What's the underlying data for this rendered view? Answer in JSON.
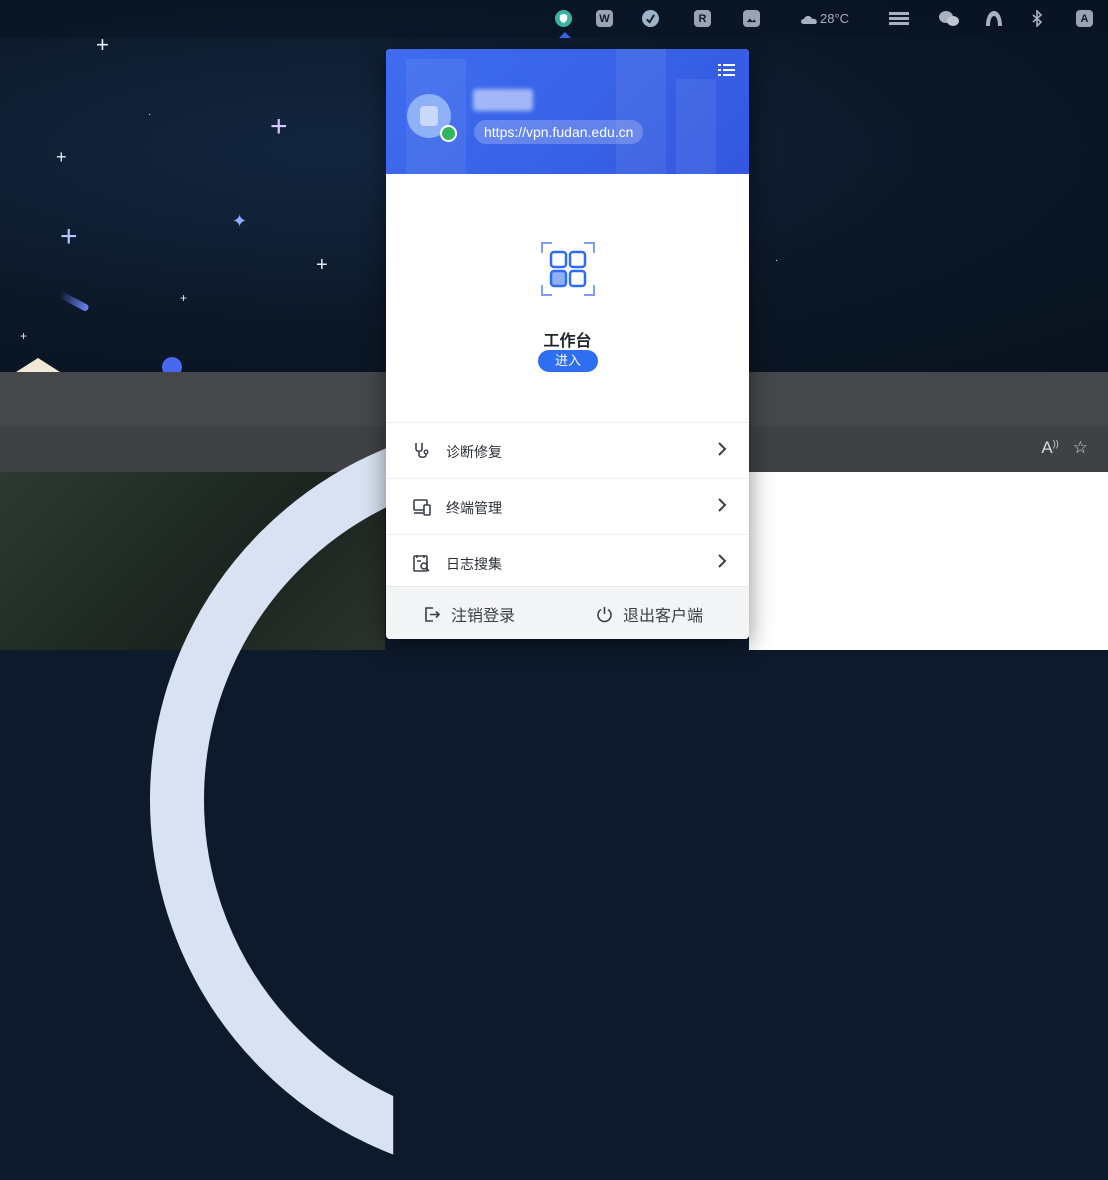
{
  "menubar": {
    "weather": "28°C",
    "tray_letters": {
      "r_app": "R",
      "input_method": "A"
    },
    "icons": [
      "vpn-shield-icon",
      "w-app-icon",
      "vision-app-icon",
      "r-app-icon",
      "image-app-icon",
      "weather-icon",
      "menu-extra-icon",
      "wechat-icon",
      "arc-app-icon",
      "bluetooth-icon",
      "input-source-icon"
    ]
  },
  "vpn": {
    "server": "https://vpn.fudan.edu.cn",
    "status": "online",
    "workbench": {
      "title": "工作台",
      "enter_label": "进入"
    },
    "menu": [
      {
        "label": "诊断修复",
        "icon": "stethoscope-icon"
      },
      {
        "label": "终端管理",
        "icon": "devices-icon"
      },
      {
        "label": "日志搜集",
        "icon": "log-search-icon"
      }
    ],
    "footer": {
      "logout_label": "注销登录",
      "quit_label": "退出客户端"
    }
  },
  "browser": {
    "read_aloud_label": "A",
    "favorite_icon": "star-icon"
  },
  "colors": {
    "accent": "#3a64ea",
    "online": "#33b45e",
    "enter_button": "#2e6ff2"
  }
}
